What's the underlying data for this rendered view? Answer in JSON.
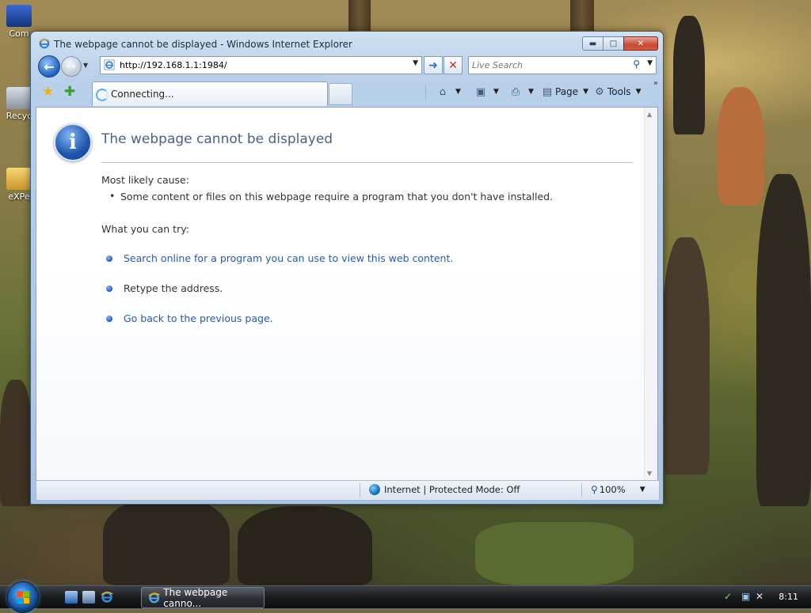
{
  "desktop": {
    "icons": [
      {
        "label": "Com"
      },
      {
        "label": "Recyc"
      },
      {
        "label": "eXPe"
      }
    ]
  },
  "window": {
    "title": "The webpage cannot be displayed - Windows Internet Explorer",
    "address_url": "http://192.168.1.1:1984/",
    "search_placeholder": "Live Search",
    "tab_label": "Connecting...",
    "commands": {
      "page_label": "Page",
      "tools_label": "Tools"
    }
  },
  "page": {
    "heading": "The webpage cannot be displayed",
    "cause_label": "Most likely cause:",
    "cause_items": [
      "Some content or files on this webpage require a program that you don't have installed."
    ],
    "try_label": "What you can try:",
    "options": [
      {
        "text": "Search online for a program you can use to view this web content.",
        "link": true
      },
      {
        "text": "Retype the address.",
        "link": false
      },
      {
        "text": "Go back to the previous page.",
        "link": true
      }
    ]
  },
  "statusbar": {
    "zone_text": "Internet | Protected Mode: Off",
    "zoom": "100%"
  },
  "taskbar": {
    "active_window_label": "The webpage canno...",
    "clock": "8:11"
  },
  "colors": {
    "link": "#2a5aa6",
    "heading": "#4a6283",
    "close_button": "#c74a33"
  }
}
